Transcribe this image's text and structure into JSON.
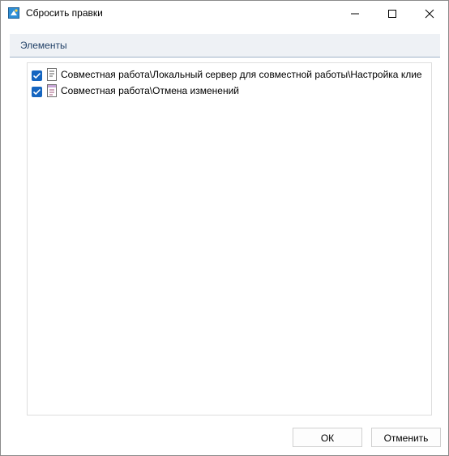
{
  "window": {
    "title": "Сбросить правки",
    "app_icon": "reset-edits-icon",
    "controls": [
      "minimize-icon",
      "maximize-icon",
      "close-icon"
    ]
  },
  "panel": {
    "header": "Элементы"
  },
  "items": [
    {
      "checked": true,
      "icon": "document-icon",
      "label": "Совместная работа\\Локальный сервер для совместной работы\\Настройка клие"
    },
    {
      "checked": true,
      "icon": "form-document-icon",
      "label": "Совместная работа\\Отмена изменений"
    }
  ],
  "buttons": {
    "ok": "ОК",
    "cancel": "Отменить"
  },
  "colors": {
    "checkbox": "#1565c0",
    "header_bg": "#eef1f5",
    "header_text": "#1f3f66"
  }
}
